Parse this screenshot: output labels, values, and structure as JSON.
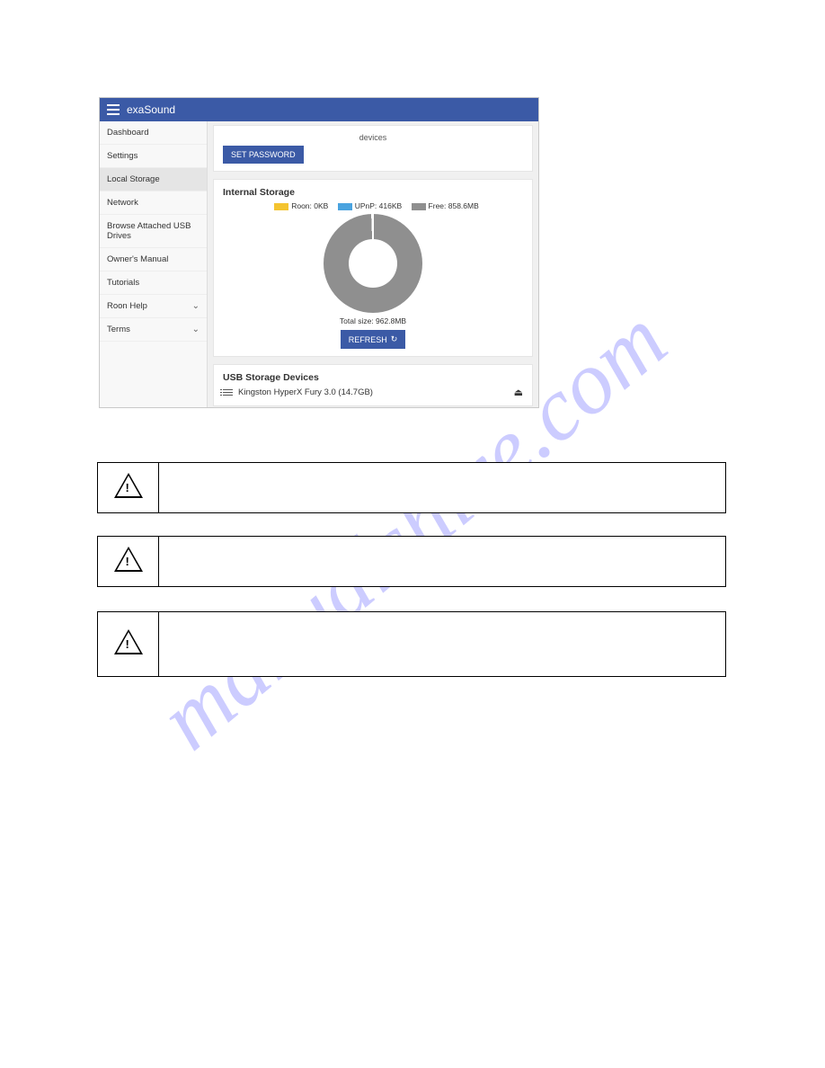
{
  "watermark": "manualshive.com",
  "app": {
    "brand": "exaSound",
    "sidebar": {
      "items": [
        {
          "label": "Dashboard"
        },
        {
          "label": "Settings"
        },
        {
          "label": "Local Storage",
          "active": true
        },
        {
          "label": "Network"
        },
        {
          "label": "Browse Attached USB Drives"
        },
        {
          "label": "Owner's Manual"
        },
        {
          "label": "Tutorials"
        },
        {
          "label": "Roon Help",
          "expandable": true
        },
        {
          "label": "Terms",
          "expandable": true
        }
      ]
    },
    "top_card": {
      "hint": "devices",
      "set_password_label": "SET PASSWORD"
    },
    "storage": {
      "title": "Internal Storage",
      "legend": {
        "roon": "Roon: 0KB",
        "upnp": "UPnP: 416KB",
        "free": "Free: 858.6MB"
      },
      "total": "Total size: 962.8MB",
      "refresh_label": "REFRESH"
    },
    "usb": {
      "title": "USB Storage Devices",
      "device": "Kingston HyperX Fury 3.0 (14.7GB)"
    }
  },
  "chart_data": {
    "type": "pie",
    "title": "Internal Storage",
    "series": [
      {
        "name": "Roon",
        "value_label": "0KB",
        "value_kb": 0
      },
      {
        "name": "UPnP",
        "value_label": "416KB",
        "value_kb": 416
      },
      {
        "name": "Free",
        "value_label": "858.6MB",
        "value_kb": 879206
      }
    ],
    "total_label": "Total size: 962.8MB",
    "total_kb": 985907
  },
  "notes": [
    {
      "text": ""
    },
    {
      "text": ""
    },
    {
      "text": ""
    }
  ]
}
